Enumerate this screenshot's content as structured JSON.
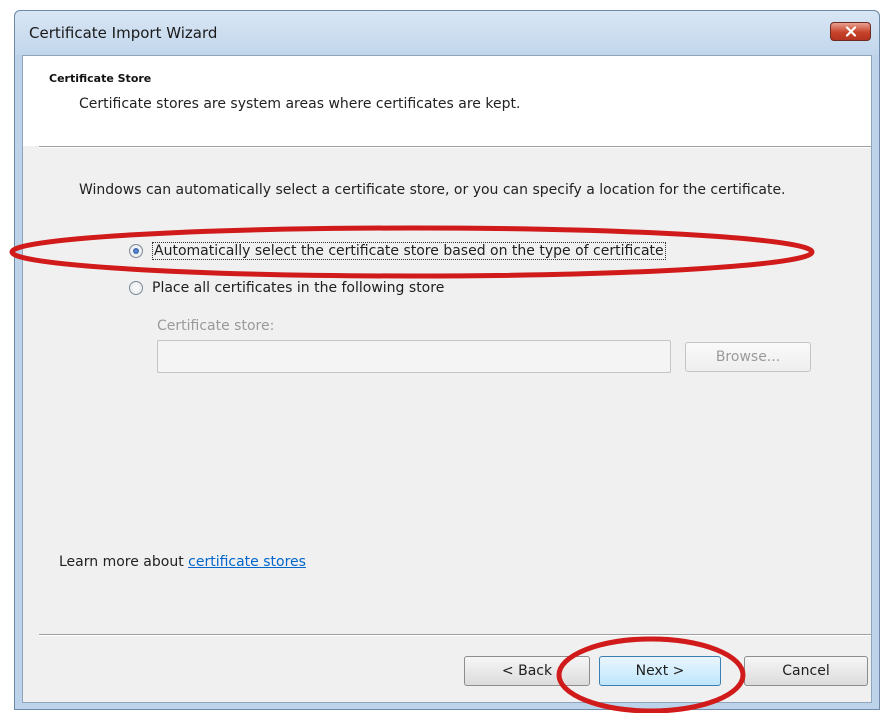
{
  "window": {
    "title": "Certificate Import Wizard",
    "close_icon": "close-x-icon"
  },
  "header": {
    "title": "Certificate Store",
    "description": "Certificate stores are system areas where certificates are kept."
  },
  "body": {
    "intro": "Windows can automatically select a certificate store, or you can specify a location for the certificate.",
    "options": [
      {
        "label": "Automatically select the certificate store based on the type of certificate",
        "selected": true
      },
      {
        "label": "Place all certificates in the following store",
        "selected": false
      }
    ],
    "store_label": "Certificate store:",
    "store_value": "",
    "browse_label": "Browse...",
    "learn_prefix": "Learn more about ",
    "learn_link": "certificate stores"
  },
  "footer": {
    "back_label": "< Back",
    "next_label": "Next >",
    "cancel_label": "Cancel"
  },
  "colors": {
    "annotation": "#d11a1a",
    "link": "#0066cc"
  }
}
